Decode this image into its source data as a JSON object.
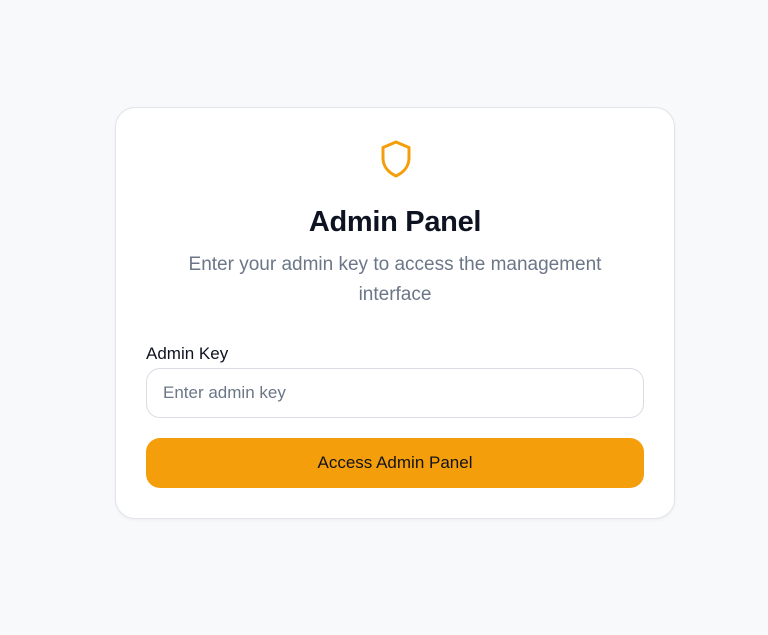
{
  "colors": {
    "background": "#f8f9fb",
    "accent": "#f59e0b",
    "title": "#0d1321",
    "muted": "#6b7687"
  },
  "card": {
    "icon": "shield-icon",
    "title": "Admin Panel",
    "subtitle": "Enter your admin key to access the management interface"
  },
  "form": {
    "key_label": "Admin Key",
    "key_value": "",
    "key_placeholder": "Enter admin key",
    "submit_label": "Access Admin Panel"
  }
}
